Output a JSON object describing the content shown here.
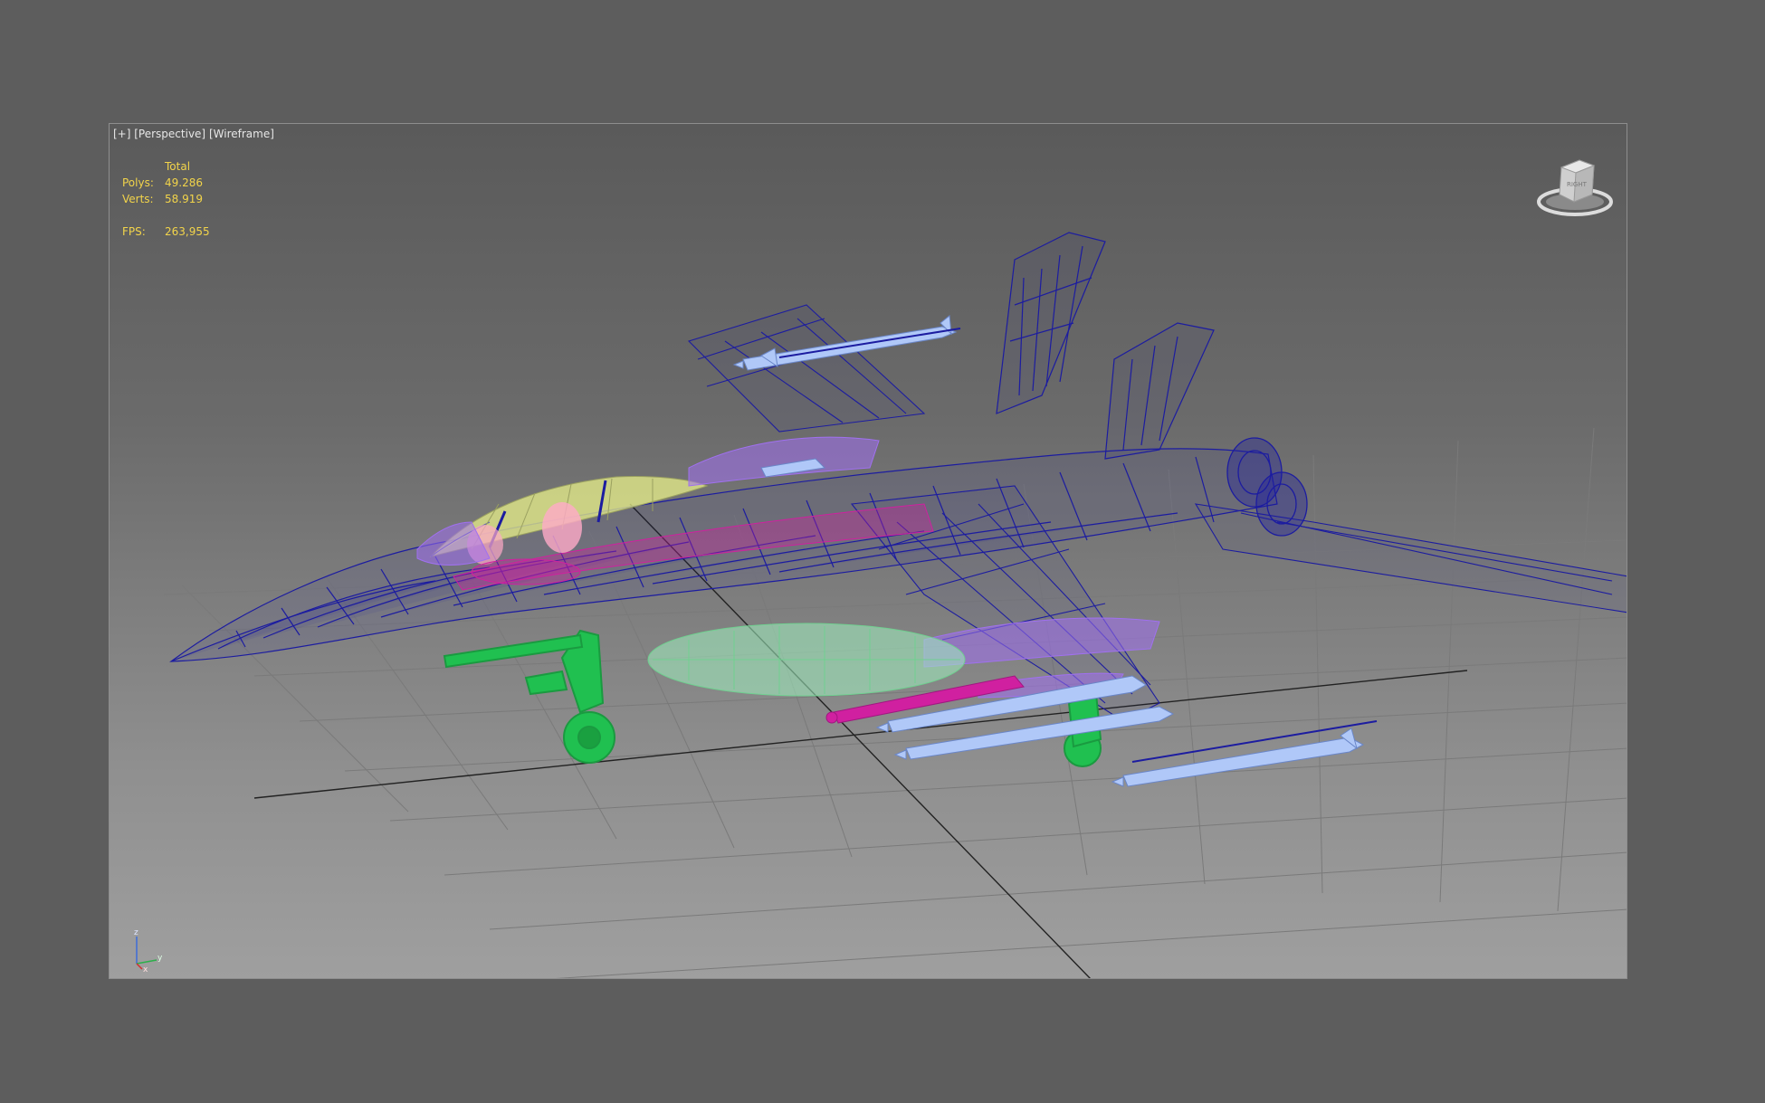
{
  "viewport": {
    "label_plus": "[+]",
    "label_view": "[Perspective]",
    "label_shading": "[Wireframe]"
  },
  "stats": {
    "header": "Total",
    "polys_label": "Polys:",
    "polys_value": "49.286",
    "verts_label": "Verts:",
    "verts_value": "58.919",
    "fps_label": "FPS:",
    "fps_value": "263,955"
  },
  "viewcube": {
    "face_label": "RIGHT"
  },
  "axes": {
    "z": "z",
    "y": "y",
    "x": "x"
  },
  "colors": {
    "background": "#5d5d5d",
    "stats_text": "#f2d44a",
    "wire_blue": "#1c1ca0",
    "wire_purple": "#a070f0",
    "wire_magenta": "#d020a0",
    "wire_green": "#20c050",
    "wire_lightgreen": "#a0f0c0",
    "wire_yellow": "#e8f08a",
    "wire_lightblue": "#b0c8f8"
  },
  "icons": {
    "viewcube": "viewcube-icon",
    "axis": "axis-tripod-icon"
  }
}
